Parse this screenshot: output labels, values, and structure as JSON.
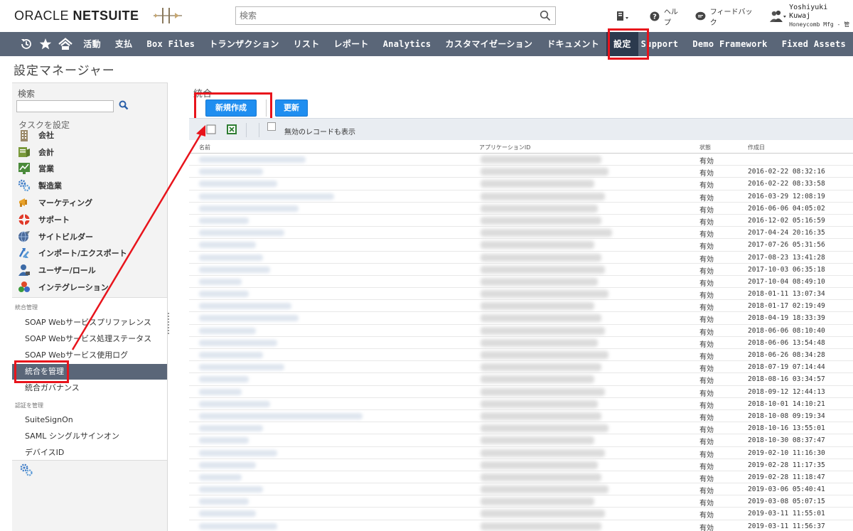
{
  "header": {
    "logo_brand": "ORACLE",
    "logo_product": "NETSUITE",
    "search_placeholder": "検索",
    "help": "ヘルプ",
    "feedback": "フィードバック",
    "user_name": "Yoshiyuki Kuwaj",
    "user_company": "Honeycomb Mfg - 管"
  },
  "nav": {
    "items": [
      {
        "label": "活動",
        "latin": false
      },
      {
        "label": "支払",
        "latin": false
      },
      {
        "label": "Box Files",
        "latin": true
      },
      {
        "label": "トランザクション",
        "latin": false
      },
      {
        "label": "リスト",
        "latin": false
      },
      {
        "label": "レポート",
        "latin": false
      },
      {
        "label": "Analytics",
        "latin": true
      },
      {
        "label": "カスタマイゼーション",
        "latin": false
      },
      {
        "label": "ドキュメント",
        "latin": false
      },
      {
        "label": "設定",
        "latin": false,
        "active": true
      },
      {
        "label": "Support",
        "latin": true
      },
      {
        "label": "Demo Framework",
        "latin": true
      },
      {
        "label": "Fixed Assets",
        "latin": true
      }
    ]
  },
  "page": {
    "title": "設定マネージャー"
  },
  "left_panel": {
    "search_label": "検索",
    "task_label": "タスクを設定",
    "tasks": [
      {
        "label": "会社",
        "icon": "building-icon"
      },
      {
        "label": "会計",
        "icon": "accounting-icon"
      },
      {
        "label": "営業",
        "icon": "sales-chart-icon"
      },
      {
        "label": "製造業",
        "icon": "gears-icon"
      },
      {
        "label": "マーケティング",
        "icon": "megaphone-icon"
      },
      {
        "label": "サポート",
        "icon": "lifebuoy-icon"
      },
      {
        "label": "サイトビルダー",
        "icon": "globe-icon"
      },
      {
        "label": "インポート/エクスポート",
        "icon": "import-export-icon"
      },
      {
        "label": "ユーザー/ロール",
        "icon": "user-icon"
      },
      {
        "label": "インテグレーション",
        "icon": "integration-icon"
      }
    ],
    "section_integration": "統合管理",
    "integration_items": [
      {
        "label": "SOAP Webサービスプリファレンス"
      },
      {
        "label": "SOAP Webサービス処理ステータス"
      },
      {
        "label": "SOAP Webサービス使用ログ"
      },
      {
        "label": "統合を管理",
        "active": true
      },
      {
        "label": "統合ガバナンス"
      }
    ],
    "section_auth": "認証を管理",
    "auth_items": [
      {
        "label": "SuiteSignOn"
      },
      {
        "label": "SAML シングルサインオン"
      },
      {
        "label": "デバイスID"
      }
    ]
  },
  "main": {
    "title": "統合",
    "new_button": "新規作成",
    "refresh_button": "更新",
    "show_inactive_label": "無効のレコードも表示",
    "columns": {
      "name": "名前",
      "app_id": "アプリケーションID",
      "status": "状態",
      "created": "作成日"
    },
    "rows": [
      {
        "status": "有効",
        "created": ""
      },
      {
        "status": "有効",
        "created": "2016-02-22 08:32:16"
      },
      {
        "status": "有効",
        "created": "2016-02-22 08:33:58"
      },
      {
        "status": "有効",
        "created": "2016-03-29 12:08:19"
      },
      {
        "status": "有効",
        "created": "2016-06-06 04:05:02"
      },
      {
        "status": "有効",
        "created": "2016-12-02 05:16:59"
      },
      {
        "status": "有効",
        "created": "2017-04-24 20:16:35"
      },
      {
        "status": "有効",
        "created": "2017-07-26 05:31:56"
      },
      {
        "status": "有効",
        "created": "2017-08-23 13:41:28"
      },
      {
        "status": "有効",
        "created": "2017-10-03 06:35:18"
      },
      {
        "status": "有効",
        "created": "2017-10-04 08:49:10"
      },
      {
        "status": "有効",
        "created": "2018-01-11 13:07:34"
      },
      {
        "status": "有効",
        "created": "2018-01-17 02:19:49"
      },
      {
        "status": "有効",
        "created": "2018-04-19 18:33:39"
      },
      {
        "status": "有効",
        "created": "2018-06-06 08:10:40"
      },
      {
        "status": "有効",
        "created": "2018-06-06 13:54:48"
      },
      {
        "status": "有効",
        "created": "2018-06-26 08:34:28"
      },
      {
        "status": "有効",
        "created": "2018-07-19 07:14:44"
      },
      {
        "status": "有効",
        "created": "2018-08-16 03:34:57"
      },
      {
        "status": "有効",
        "created": "2018-09-12 12:44:13"
      },
      {
        "status": "有効",
        "created": "2018-10-01 14:10:21"
      },
      {
        "status": "有効",
        "created": "2018-10-08 09:19:34"
      },
      {
        "status": "有効",
        "created": "2018-10-16 13:55:01"
      },
      {
        "status": "有効",
        "created": "2018-10-30 08:37:47"
      },
      {
        "status": "有効",
        "created": "2019-02-10 11:16:30"
      },
      {
        "status": "有効",
        "created": "2019-02-28 11:17:35"
      },
      {
        "status": "有効",
        "created": "2019-02-28 11:18:47"
      },
      {
        "status": "有効",
        "created": "2019-03-06 05:40:41"
      },
      {
        "status": "有効",
        "created": "2019-03-08 05:07:15"
      },
      {
        "status": "有効",
        "created": "2019-03-11 11:55:01"
      },
      {
        "status": "有効",
        "created": "2019-03-11 11:56:37"
      }
    ]
  },
  "colors": {
    "nav_bg": "#5a6678",
    "nav_active": "#2c3a4e",
    "button_blue": "#1f8ef0",
    "annotation_red": "#e8141c"
  }
}
